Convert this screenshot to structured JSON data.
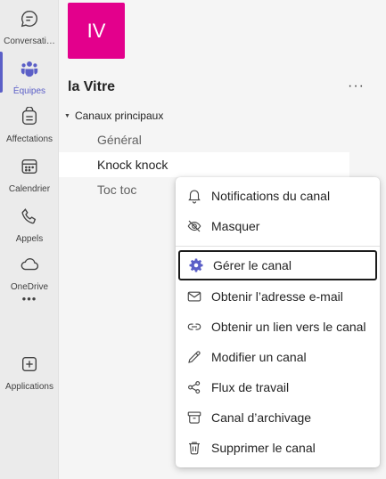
{
  "rail": {
    "items": [
      {
        "label": "Conversati…",
        "icon": "chat-icon"
      },
      {
        "label": "Équipes",
        "icon": "teams-icon"
      },
      {
        "label": "Affectations",
        "icon": "assignments-icon"
      },
      {
        "label": "Calendrier",
        "icon": "calendar-icon"
      },
      {
        "label": "Appels",
        "icon": "phone-icon"
      },
      {
        "label": "OneDrive",
        "icon": "cloud-icon"
      },
      {
        "label": "",
        "icon": "more-apps-icon"
      },
      {
        "label": "Applications",
        "icon": "add-app-icon"
      }
    ],
    "more_glyph": "•••",
    "active_color": "#5b5fc7"
  },
  "team": {
    "avatar_initials": "IV",
    "avatar_color": "#e3008c",
    "name": "la Vitre",
    "more_glyph": "···",
    "section_label": "Canaux principaux",
    "channels": [
      {
        "name": "Général"
      },
      {
        "name": "Knock knock"
      },
      {
        "name": "Toc toc"
      }
    ]
  },
  "context_menu": {
    "items": [
      {
        "label": "Notifications du canal",
        "icon": "bell-icon"
      },
      {
        "label": "Masquer",
        "icon": "eye-off-icon"
      },
      {
        "label": "Gérer le canal",
        "icon": "gear-icon"
      },
      {
        "label": "Obtenir l’adresse e-mail",
        "icon": "mail-icon"
      },
      {
        "label": "Obtenir un lien vers le canal",
        "icon": "link-icon"
      },
      {
        "label": "Modifier un canal",
        "icon": "pencil-icon"
      },
      {
        "label": "Flux de travail",
        "icon": "workflow-icon"
      },
      {
        "label": "Canal d’archivage",
        "icon": "archive-icon"
      },
      {
        "label": "Supprimer le canal",
        "icon": "trash-icon"
      }
    ]
  }
}
